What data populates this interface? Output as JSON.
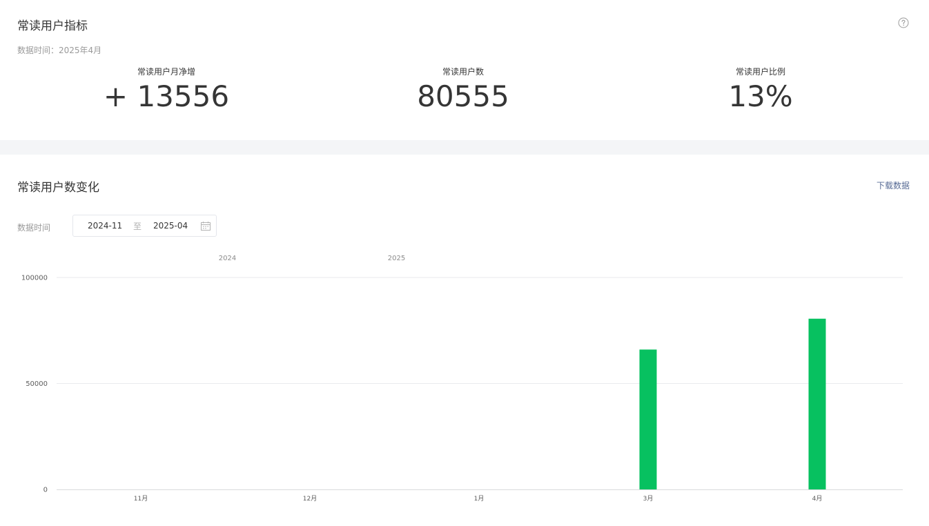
{
  "indicators": {
    "title": "常读用户指标",
    "data_time": "数据时间：2025年4月",
    "help_icon": "question-circle-icon",
    "metrics": [
      {
        "label": "常读用户月净增",
        "value": "+ 13556"
      },
      {
        "label": "常读用户数",
        "value": "80555"
      },
      {
        "label": "常读用户比例",
        "value": "13%"
      }
    ]
  },
  "trend": {
    "title": "常读用户数变化",
    "download_label": "下载数据",
    "range_label": "数据时间",
    "range_start": "2024-11",
    "range_separator": "至",
    "range_end": "2025-04",
    "calendar_icon": "calendar-icon"
  },
  "colors": {
    "bar": "#07c160",
    "link": "#576b95",
    "grid": "#e9eaee"
  },
  "chart_data": {
    "type": "bar",
    "categories": [
      "11月",
      "12月",
      "1月",
      "3月",
      "4月"
    ],
    "year_labels": [
      {
        "label": "2024",
        "between": [
          "11月",
          "12月"
        ]
      },
      {
        "label": "2025",
        "between": [
          "12月",
          "1月"
        ]
      }
    ],
    "values": [
      0,
      0,
      0,
      66000,
      80555
    ],
    "ylim": [
      0,
      100000
    ],
    "yticks": [
      0,
      50000,
      100000
    ],
    "ytick_labels": [
      "0",
      "50000",
      "100000"
    ],
    "grid": true,
    "legend": "none"
  }
}
